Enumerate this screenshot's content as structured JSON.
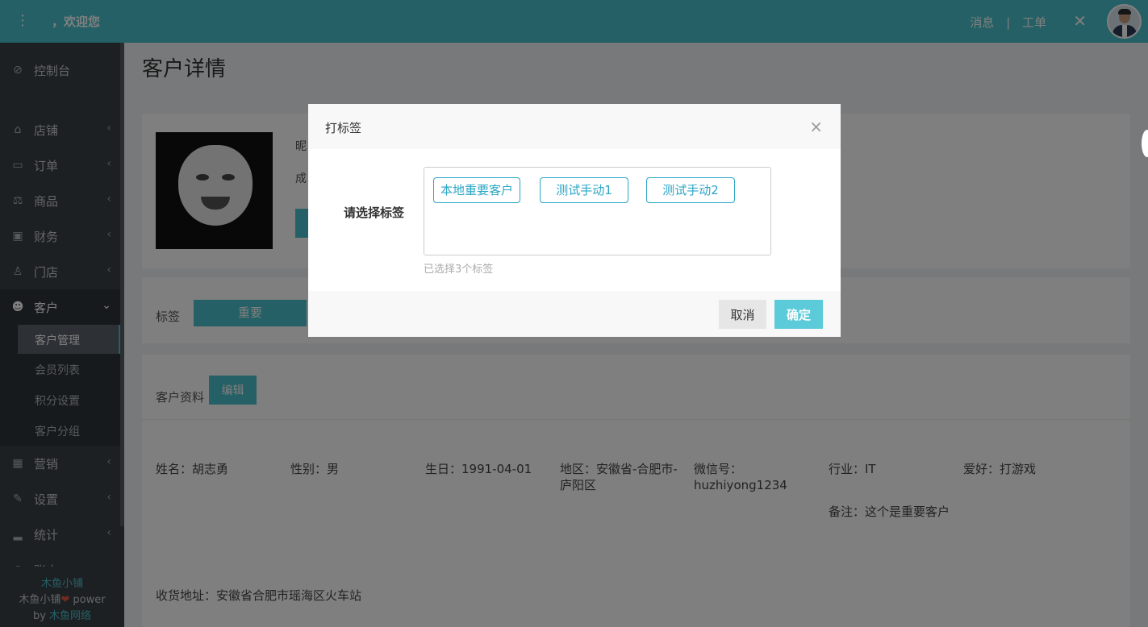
{
  "topbar": {
    "menu_icon": "⋮",
    "welcome": "，欢迎您",
    "messages": "消息",
    "separator": "|",
    "tickets": "工单",
    "tools_icon": "✕"
  },
  "sidebar": {
    "items": [
      {
        "label": "控制台",
        "icon": "dashboard-icon"
      },
      {
        "label": "店铺",
        "icon": "store-icon"
      },
      {
        "label": "订单",
        "icon": "order-icon"
      },
      {
        "label": "商品",
        "icon": "product-icon"
      },
      {
        "label": "财务",
        "icon": "finance-icon"
      },
      {
        "label": "门店",
        "icon": "branch-icon"
      },
      {
        "label": "客户",
        "icon": "users-icon"
      },
      {
        "label": "营销",
        "icon": "marketing-icon"
      },
      {
        "label": "设置",
        "icon": "wrench-icon"
      },
      {
        "label": "统计",
        "icon": "stats-icon"
      },
      {
        "label": "账户",
        "icon": "account-icon"
      }
    ],
    "sub_items": [
      "客户管理",
      "会员列表",
      "积分设置",
      "客户分组"
    ],
    "footer": {
      "brand": "木鱼小铺",
      "power_prefix": "木鱼小铺",
      "power_suffix": " power",
      "by": "by ",
      "by_link": "木鱼网络"
    }
  },
  "main": {
    "page_title": "客户详情",
    "profile": {
      "line1": "昵",
      "line2": "成"
    },
    "tags": {
      "label": "标签",
      "chip": "重要"
    },
    "info": {
      "title": "客户资料",
      "edit_label": "编辑",
      "name": "姓名：胡志勇",
      "gender": "性别：男",
      "birthday": "生日：1991-04-01",
      "region": "地区：安徽省-合肥市-庐阳区",
      "wechat": "微信号：huzhiyong1234",
      "industry": "行业：IT",
      "hobby": "爱好：打游戏",
      "note": "备注：这个是重要客户",
      "address": "收货地址：安徽省合肥市瑶海区火车站"
    }
  },
  "modal": {
    "title": "打标签",
    "close_icon": "×",
    "select_label": "请选择标签",
    "tags": [
      "本地重要客户",
      "测试手动1",
      "测试手动2"
    ],
    "selected_count": "已选择3个标签",
    "cancel_label": "取消",
    "ok_label": "确定"
  },
  "colors": {
    "accent": "#49c1ca",
    "tag_border": "#2aa6c5",
    "sidebar_bg": "#3a4046",
    "ok_button": "#5bcbd9"
  }
}
